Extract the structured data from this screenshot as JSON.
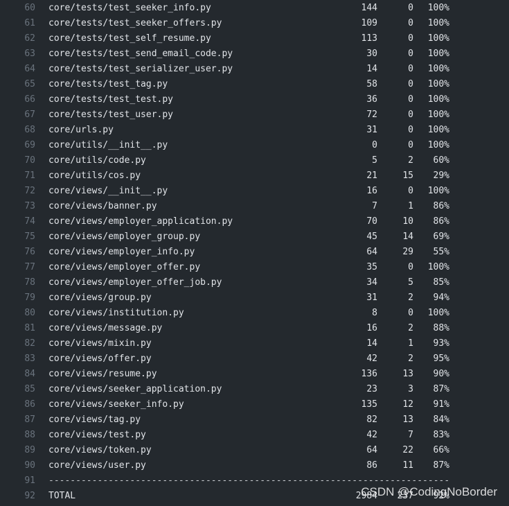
{
  "rows": [
    {
      "ln": "60",
      "file": "core/tests/test_seeker_info.py",
      "stmts": "144",
      "miss": "0",
      "cover": "100%"
    },
    {
      "ln": "61",
      "file": "core/tests/test_seeker_offers.py",
      "stmts": "109",
      "miss": "0",
      "cover": "100%"
    },
    {
      "ln": "62",
      "file": "core/tests/test_self_resume.py",
      "stmts": "113",
      "miss": "0",
      "cover": "100%"
    },
    {
      "ln": "63",
      "file": "core/tests/test_send_email_code.py",
      "stmts": "30",
      "miss": "0",
      "cover": "100%"
    },
    {
      "ln": "64",
      "file": "core/tests/test_serializer_user.py",
      "stmts": "14",
      "miss": "0",
      "cover": "100%"
    },
    {
      "ln": "65",
      "file": "core/tests/test_tag.py",
      "stmts": "58",
      "miss": "0",
      "cover": "100%"
    },
    {
      "ln": "66",
      "file": "core/tests/test_test.py",
      "stmts": "36",
      "miss": "0",
      "cover": "100%"
    },
    {
      "ln": "67",
      "file": "core/tests/test_user.py",
      "stmts": "72",
      "miss": "0",
      "cover": "100%"
    },
    {
      "ln": "68",
      "file": "core/urls.py",
      "stmts": "31",
      "miss": "0",
      "cover": "100%"
    },
    {
      "ln": "69",
      "file": "core/utils/__init__.py",
      "stmts": "0",
      "miss": "0",
      "cover": "100%"
    },
    {
      "ln": "70",
      "file": "core/utils/code.py",
      "stmts": "5",
      "miss": "2",
      "cover": "60%"
    },
    {
      "ln": "71",
      "file": "core/utils/cos.py",
      "stmts": "21",
      "miss": "15",
      "cover": "29%"
    },
    {
      "ln": "72",
      "file": "core/views/__init__.py",
      "stmts": "16",
      "miss": "0",
      "cover": "100%"
    },
    {
      "ln": "73",
      "file": "core/views/banner.py",
      "stmts": "7",
      "miss": "1",
      "cover": "86%"
    },
    {
      "ln": "74",
      "file": "core/views/employer_application.py",
      "stmts": "70",
      "miss": "10",
      "cover": "86%"
    },
    {
      "ln": "75",
      "file": "core/views/employer_group.py",
      "stmts": "45",
      "miss": "14",
      "cover": "69%"
    },
    {
      "ln": "76",
      "file": "core/views/employer_info.py",
      "stmts": "64",
      "miss": "29",
      "cover": "55%"
    },
    {
      "ln": "77",
      "file": "core/views/employer_offer.py",
      "stmts": "35",
      "miss": "0",
      "cover": "100%"
    },
    {
      "ln": "78",
      "file": "core/views/employer_offer_job.py",
      "stmts": "34",
      "miss": "5",
      "cover": "85%"
    },
    {
      "ln": "79",
      "file": "core/views/group.py",
      "stmts": "31",
      "miss": "2",
      "cover": "94%"
    },
    {
      "ln": "80",
      "file": "core/views/institution.py",
      "stmts": "8",
      "miss": "0",
      "cover": "100%"
    },
    {
      "ln": "81",
      "file": "core/views/message.py",
      "stmts": "16",
      "miss": "2",
      "cover": "88%"
    },
    {
      "ln": "82",
      "file": "core/views/mixin.py",
      "stmts": "14",
      "miss": "1",
      "cover": "93%"
    },
    {
      "ln": "83",
      "file": "core/views/offer.py",
      "stmts": "42",
      "miss": "2",
      "cover": "95%"
    },
    {
      "ln": "84",
      "file": "core/views/resume.py",
      "stmts": "136",
      "miss": "13",
      "cover": "90%"
    },
    {
      "ln": "85",
      "file": "core/views/seeker_application.py",
      "stmts": "23",
      "miss": "3",
      "cover": "87%"
    },
    {
      "ln": "86",
      "file": "core/views/seeker_info.py",
      "stmts": "135",
      "miss": "12",
      "cover": "91%"
    },
    {
      "ln": "87",
      "file": "core/views/tag.py",
      "stmts": "82",
      "miss": "13",
      "cover": "84%"
    },
    {
      "ln": "88",
      "file": "core/views/test.py",
      "stmts": "42",
      "miss": "7",
      "cover": "83%"
    },
    {
      "ln": "89",
      "file": "core/views/token.py",
      "stmts": "64",
      "miss": "22",
      "cover": "66%"
    },
    {
      "ln": "90",
      "file": "core/views/user.py",
      "stmts": "86",
      "miss": "11",
      "cover": "87%"
    }
  ],
  "separator": {
    "ln": "91",
    "text": "----------------------------------------------------------------------------"
  },
  "total": {
    "ln": "92",
    "file": "TOTAL",
    "stmts": "2984",
    "miss": "237",
    "cover": "92%"
  },
  "watermark": "CSDN @CodingNoBorder",
  "colors": {
    "background": "#24292e",
    "text": "#e1e4e8",
    "line_number": "#6a737d"
  }
}
